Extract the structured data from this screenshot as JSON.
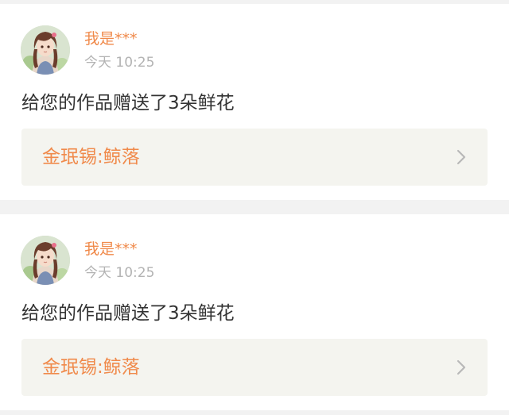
{
  "colors": {
    "accent": "#f08a4b",
    "timestamp": "#b3b3b3",
    "message_text": "#333333",
    "card_bg": "#ffffff",
    "link_bg": "#f4f4ef",
    "page_bg": "#f2f2f2"
  },
  "notifications": [
    {
      "avatar_icon": "anime-girl-avatar-icon",
      "username": "我是***",
      "time": "今天 10:25",
      "message": "给您的作品赠送了3朵鲜花",
      "work_title": "金珉锡:鲸落",
      "chevron_icon": "chevron-right-icon"
    },
    {
      "avatar_icon": "anime-girl-avatar-icon",
      "username": "我是***",
      "time": "今天 10:25",
      "message": "给您的作品赠送了3朵鲜花",
      "work_title": "金珉锡:鲸落",
      "chevron_icon": "chevron-right-icon"
    }
  ]
}
